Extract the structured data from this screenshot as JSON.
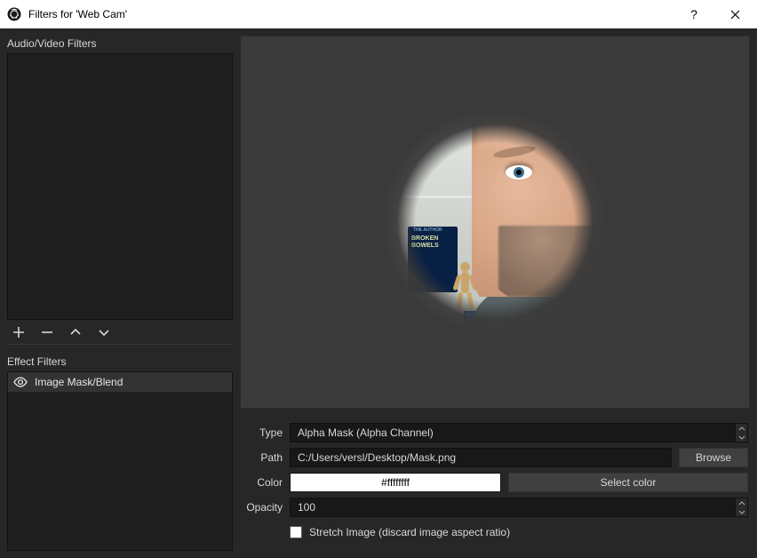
{
  "titlebar": {
    "title": "Filters for 'Web Cam'"
  },
  "left": {
    "audio_label": "Audio/Video Filters",
    "effect_label": "Effect Filters",
    "effect_items": [
      {
        "name": "Image Mask/Blend"
      }
    ]
  },
  "form": {
    "type_label": "Type",
    "type_value": "Alpha Mask (Alpha Channel)",
    "path_label": "Path",
    "path_value": "C:/Users/versl/Desktop/Mask.png",
    "browse_label": "Browse",
    "color_label": "Color",
    "color_value": "#ffffffff",
    "select_color_label": "Select color",
    "opacity_label": "Opacity",
    "opacity_value": "100",
    "stretch_label": "Stretch Image (discard image aspect ratio)",
    "stretch_checked": false
  },
  "preview": {
    "book_title_line1": "BROKEN",
    "book_title_line2": "BOWELS",
    "book_top": "THE AUTHOR"
  }
}
